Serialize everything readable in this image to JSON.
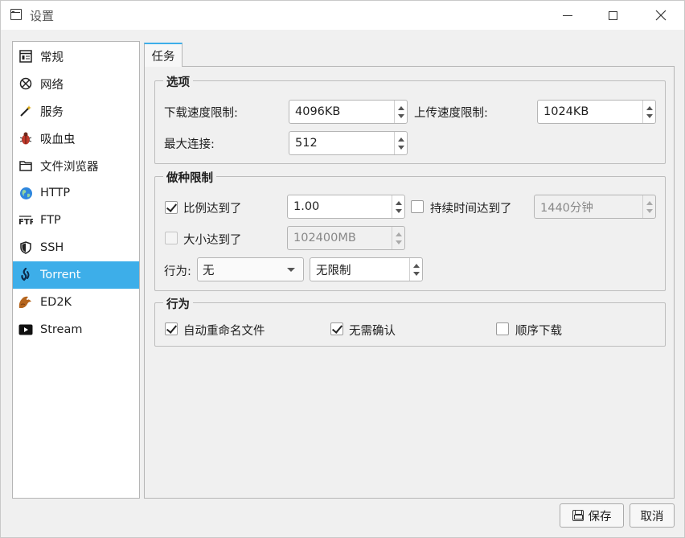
{
  "window": {
    "title": "设置"
  },
  "sidebar": {
    "items": [
      {
        "label": "常规",
        "icon": "general-icon"
      },
      {
        "label": "网络",
        "icon": "network-icon"
      },
      {
        "label": "服务",
        "icon": "wand-icon"
      },
      {
        "label": "吸血虫",
        "icon": "bug-icon"
      },
      {
        "label": "文件浏览器",
        "icon": "folder-icon"
      },
      {
        "label": "HTTP",
        "icon": "globe-icon"
      },
      {
        "label": "FTP",
        "icon": "ftp-icon"
      },
      {
        "label": "SSH",
        "icon": "shield-icon"
      },
      {
        "label": "Torrent",
        "icon": "torrent-icon"
      },
      {
        "label": "ED2K",
        "icon": "ed2k-icon"
      },
      {
        "label": "Stream",
        "icon": "play-icon"
      }
    ],
    "selected": "Torrent"
  },
  "tabs": [
    {
      "label": "任务"
    }
  ],
  "options": {
    "title": "选项",
    "download_limit_label": "下载速度限制:",
    "download_limit_value": "4096KB",
    "upload_limit_label": "上传速度限制:",
    "upload_limit_value": "1024KB",
    "max_conn_label": "最大连接:",
    "max_conn_value": "512"
  },
  "seeding": {
    "title": "做种限制",
    "ratio_label": "比例达到了",
    "ratio_checked": true,
    "ratio_value": "1.00",
    "duration_label": "持续时间达到了",
    "duration_checked": false,
    "duration_value": "1440分钟",
    "size_label": "大小达到了",
    "size_checked": false,
    "size_value": "102400MB",
    "action_label": "行为:",
    "action_value": "无",
    "limit_value": "无限制"
  },
  "behavior": {
    "title": "行为",
    "auto_rename_label": "自动重命名文件",
    "auto_rename_checked": true,
    "no_confirm_label": "无需确认",
    "no_confirm_checked": true,
    "sequential_label": "顺序下载",
    "sequential_checked": false
  },
  "footer": {
    "save_label": "保存",
    "cancel_label": "取消"
  },
  "colors": {
    "accent": "#3daee9"
  }
}
